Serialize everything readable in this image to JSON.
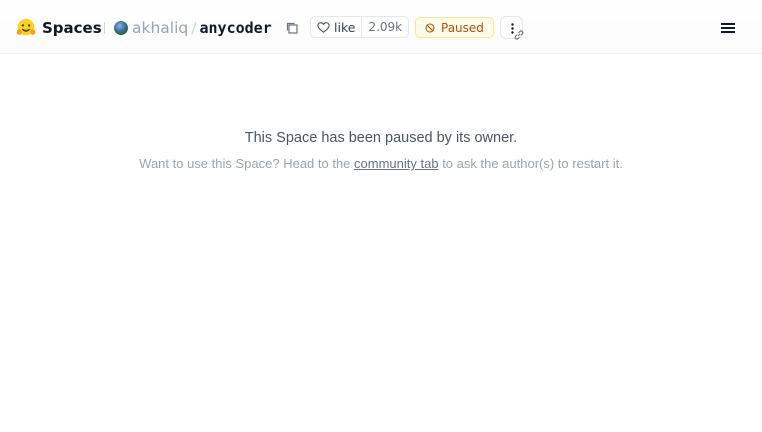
{
  "header": {
    "brand": {
      "label": "Spaces",
      "icon": "hugging-face-logo-icon"
    },
    "owner": {
      "name": "akhaliq",
      "avatar": "avatar"
    },
    "separator": "/",
    "repo": {
      "name": "anycoder"
    },
    "copy_icon": "copy-icon",
    "like": {
      "label": "like",
      "count": "2.09k",
      "icon": "heart-icon"
    },
    "status": {
      "label": "Paused",
      "icon": "pause-circle-icon",
      "color": "#b45309",
      "background": "#fffbeb"
    },
    "more_icon": "vertical-dots-icon",
    "link_icon": "link-icon",
    "menu_icon": "hamburger-menu-icon"
  },
  "main": {
    "title": "This Space has been paused by its owner.",
    "sub_before": "Want to use this Space? Head to the ",
    "sub_link": "community tab",
    "sub_after": " to ask the author(s) to restart it."
  },
  "colors": {
    "brand_yellow": "#ffd21e",
    "status_text": "#b45309",
    "text_muted": "#9ca3af"
  }
}
